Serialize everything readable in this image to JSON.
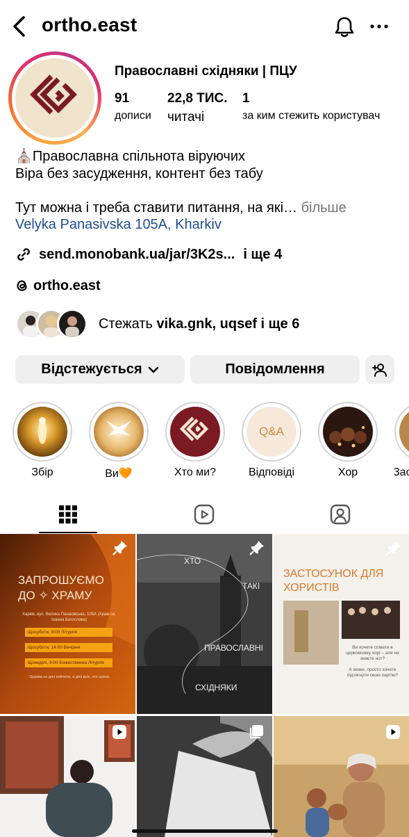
{
  "header": {
    "username": "ortho.east",
    "back_icon": "chevron-left-icon",
    "bell_icon": "bell-icon",
    "more_icon": "more-horizontal-icon"
  },
  "profile": {
    "full_name": "Православні східняки | ПЦУ",
    "stats": [
      {
        "value": "91",
        "label": "дописи"
      },
      {
        "value": "22,8 ТИС.",
        "label": "читачі"
      },
      {
        "value": "1",
        "label": "за ким стежить користувач"
      }
    ],
    "bio": {
      "line1": "⛪Православна спільнота віруючих",
      "line2": "Віра без засудження, контент без табу",
      "line3": "",
      "line4": "Тут можна і треба ставити питання, на які…",
      "more": " більше",
      "address": "Velyka Panasivska 105A, Kharkiv"
    },
    "link": {
      "text": "send.monobank.ua/jar/3K2s...",
      "extra": "і ще 4"
    },
    "threads": "ortho.east",
    "followed_by": {
      "prefix": "Стежать ",
      "names": "vika.gnk, uqsef",
      "suffix": " і ще 6"
    }
  },
  "buttons": {
    "following": "Відстежується",
    "message": "Повідомлення"
  },
  "highlights": [
    {
      "label": "Збір"
    },
    {
      "label": "Ви🧡"
    },
    {
      "label": "Хто ми?"
    },
    {
      "label": "Відповіді",
      "inner_text": "Q&A"
    },
    {
      "label": "Хор"
    },
    {
      "label": "Зас"
    }
  ],
  "tabs": [
    "grid-icon",
    "reels-icon",
    "tagged-icon"
  ],
  "posts": {
    "p1": {
      "title": "ЗАПРОШУЄМО ДО ✧ ХРАМУ",
      "address": "Харків, вул. Велика Панасівська, 105А (Храм св. Іоанна Богослова)",
      "rows": [
        "Щосуботи, 9:00 Літургія",
        "Щосуботи, 14:00 Вечірня",
        "Щонеділі, 9:00 Божественна Літургія"
      ],
      "footer": "Церква не для ковчегів, а для всіх, хто шукає"
    },
    "p2": {
      "words": [
        "ХТО",
        "ТАКІ",
        "ПРАВОСЛАВНІ",
        "СХІДНЯКИ"
      ]
    },
    "p3": {
      "title": "ЗАСТОСУНОК ДЛЯ ХОРИСТІВ",
      "q1": "Ви хочете співати в церковному хорі – але не знаєте нот?",
      "q2": "А може, просто хочете підтягнути свою партію?"
    }
  },
  "colors": {
    "brand_bg": "#efe3cb",
    "brand_red": "#7b1a22",
    "link_blue": "#1f4c8f",
    "grey_text": "#737373",
    "button_bg": "#efefef"
  }
}
